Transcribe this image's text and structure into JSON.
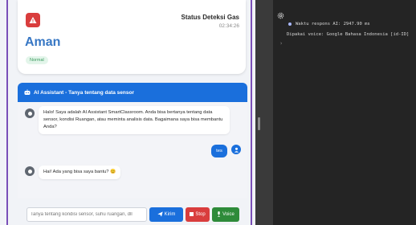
{
  "status_card": {
    "title": "Status Deteksi Gas",
    "time": "02:34:26",
    "status": "Aman",
    "badge": "Normal"
  },
  "chat": {
    "header": "AI Assistant - Tanya tentang data sensor",
    "messages": [
      {
        "role": "bot",
        "text": "Halo! Saya adalah AI Assistant SmartClassroom. Anda bisa bertanya tentang data sensor, kondisi Ruangan, atau meminta analisis data. Bagaimana saya bisa membantu Anda?"
      },
      {
        "role": "user",
        "text": "tes"
      },
      {
        "role": "bot",
        "text": "Hai! Ada yang bisa saya bantu? 😊"
      }
    ],
    "input_placeholder": "Tanya tentang kondisi sensor, suhu ruangan, dll",
    "send_label": "Kirim",
    "stop_label": "Stop",
    "voice_label": "Voice"
  },
  "console": {
    "lines": [
      "Waktu respons AI: 2947.90 ms",
      "Dipakai voice: Google Bahasa Indonesia [id-ID]"
    ],
    "prompt": "›"
  },
  "colors": {
    "accent_blue": "#1a6fdc",
    "danger_red": "#d93d3d",
    "success_green": "#2e8b3a",
    "frame_purple": "#7a4fb8",
    "console_bg": "#242424"
  }
}
